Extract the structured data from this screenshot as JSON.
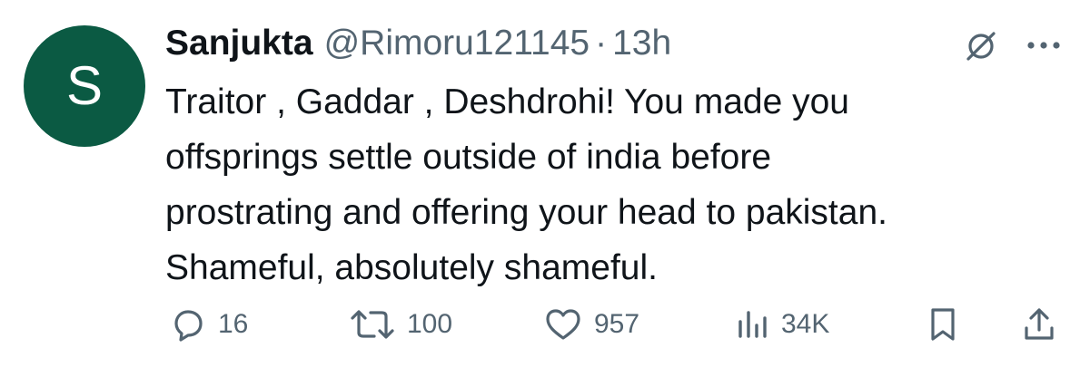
{
  "tweet": {
    "avatar_letter": "S",
    "avatar_color": "#0b5a43",
    "display_name": "Sanjukta",
    "handle": "@Rimoru121145",
    "separator": "·",
    "time": "13h",
    "text_lines": [
      "Traitor , Gaddar , Deshdrohi! You made you",
      "offsprings settle outside of india before",
      "prostrating and offering your head to pakistan.",
      "Shameful, absolutely shameful."
    ]
  },
  "actions": {
    "replies": "16",
    "reposts": "100",
    "likes": "957",
    "views": "34K"
  },
  "icons": {
    "top_right": [
      "grok-icon",
      "more-icon"
    ],
    "actions": [
      "reply-icon",
      "repost-icon",
      "like-icon",
      "views-icon",
      "bookmark-icon",
      "share-icon"
    ]
  },
  "colors": {
    "text": "#0f1419",
    "secondary": "#536471",
    "background": "#ffffff"
  }
}
